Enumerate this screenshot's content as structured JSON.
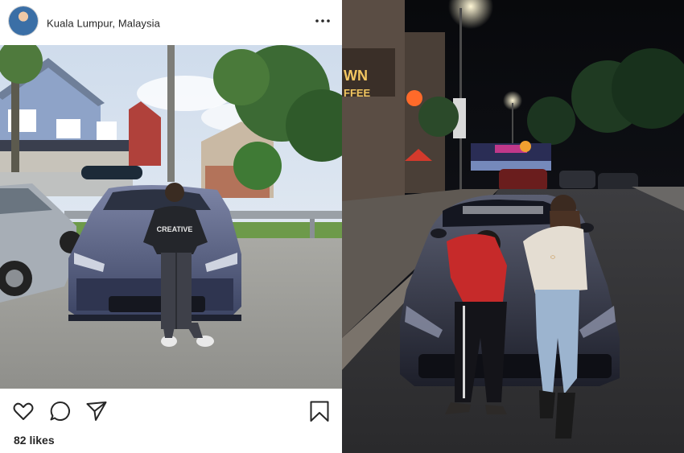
{
  "post": {
    "location": "Kuala Lumpur, Malaysia",
    "likes": "82 likes",
    "icons": {
      "more": "more-options-icon",
      "like": "heart-icon",
      "comment": "comment-icon",
      "share": "share-icon",
      "save": "bookmark-icon"
    }
  },
  "photo_left": {
    "shirt_text": "CREATIVE"
  },
  "photo_right": {
    "sign_text_1": "WN",
    "sign_text_2": "FFEE"
  }
}
